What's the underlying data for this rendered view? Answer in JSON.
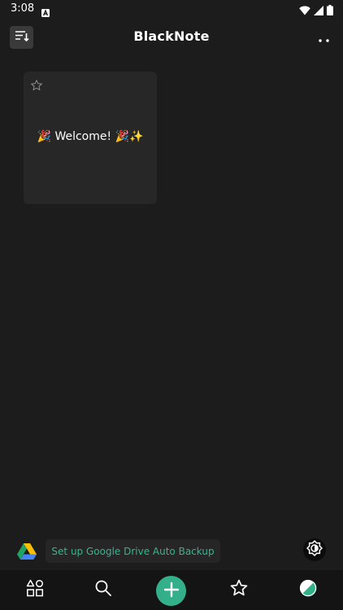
{
  "status_bar": {
    "time": "3:08"
  },
  "app_bar": {
    "title": "BlackNote"
  },
  "notes": [
    {
      "title": "🎉 Welcome! 🎉✨",
      "starred": false
    }
  ],
  "backup": {
    "label": "Set up Google Drive Auto Backup"
  },
  "colors": {
    "background": "#1c1c1c",
    "card": "#272727",
    "accent": "#33b08a",
    "accent_text": "#35b58e",
    "nav_background": "#141414"
  },
  "icons": {
    "sort": "sort-icon",
    "more": "more-dots-icon",
    "star": "star-outline-icon",
    "drive": "google-drive-icon",
    "brightness": "brightness-icon",
    "nav_categories": "shapes-icon",
    "nav_search": "search-icon",
    "nav_add": "plus-icon",
    "nav_favorites": "star-icon",
    "nav_theme": "theme-icon"
  }
}
